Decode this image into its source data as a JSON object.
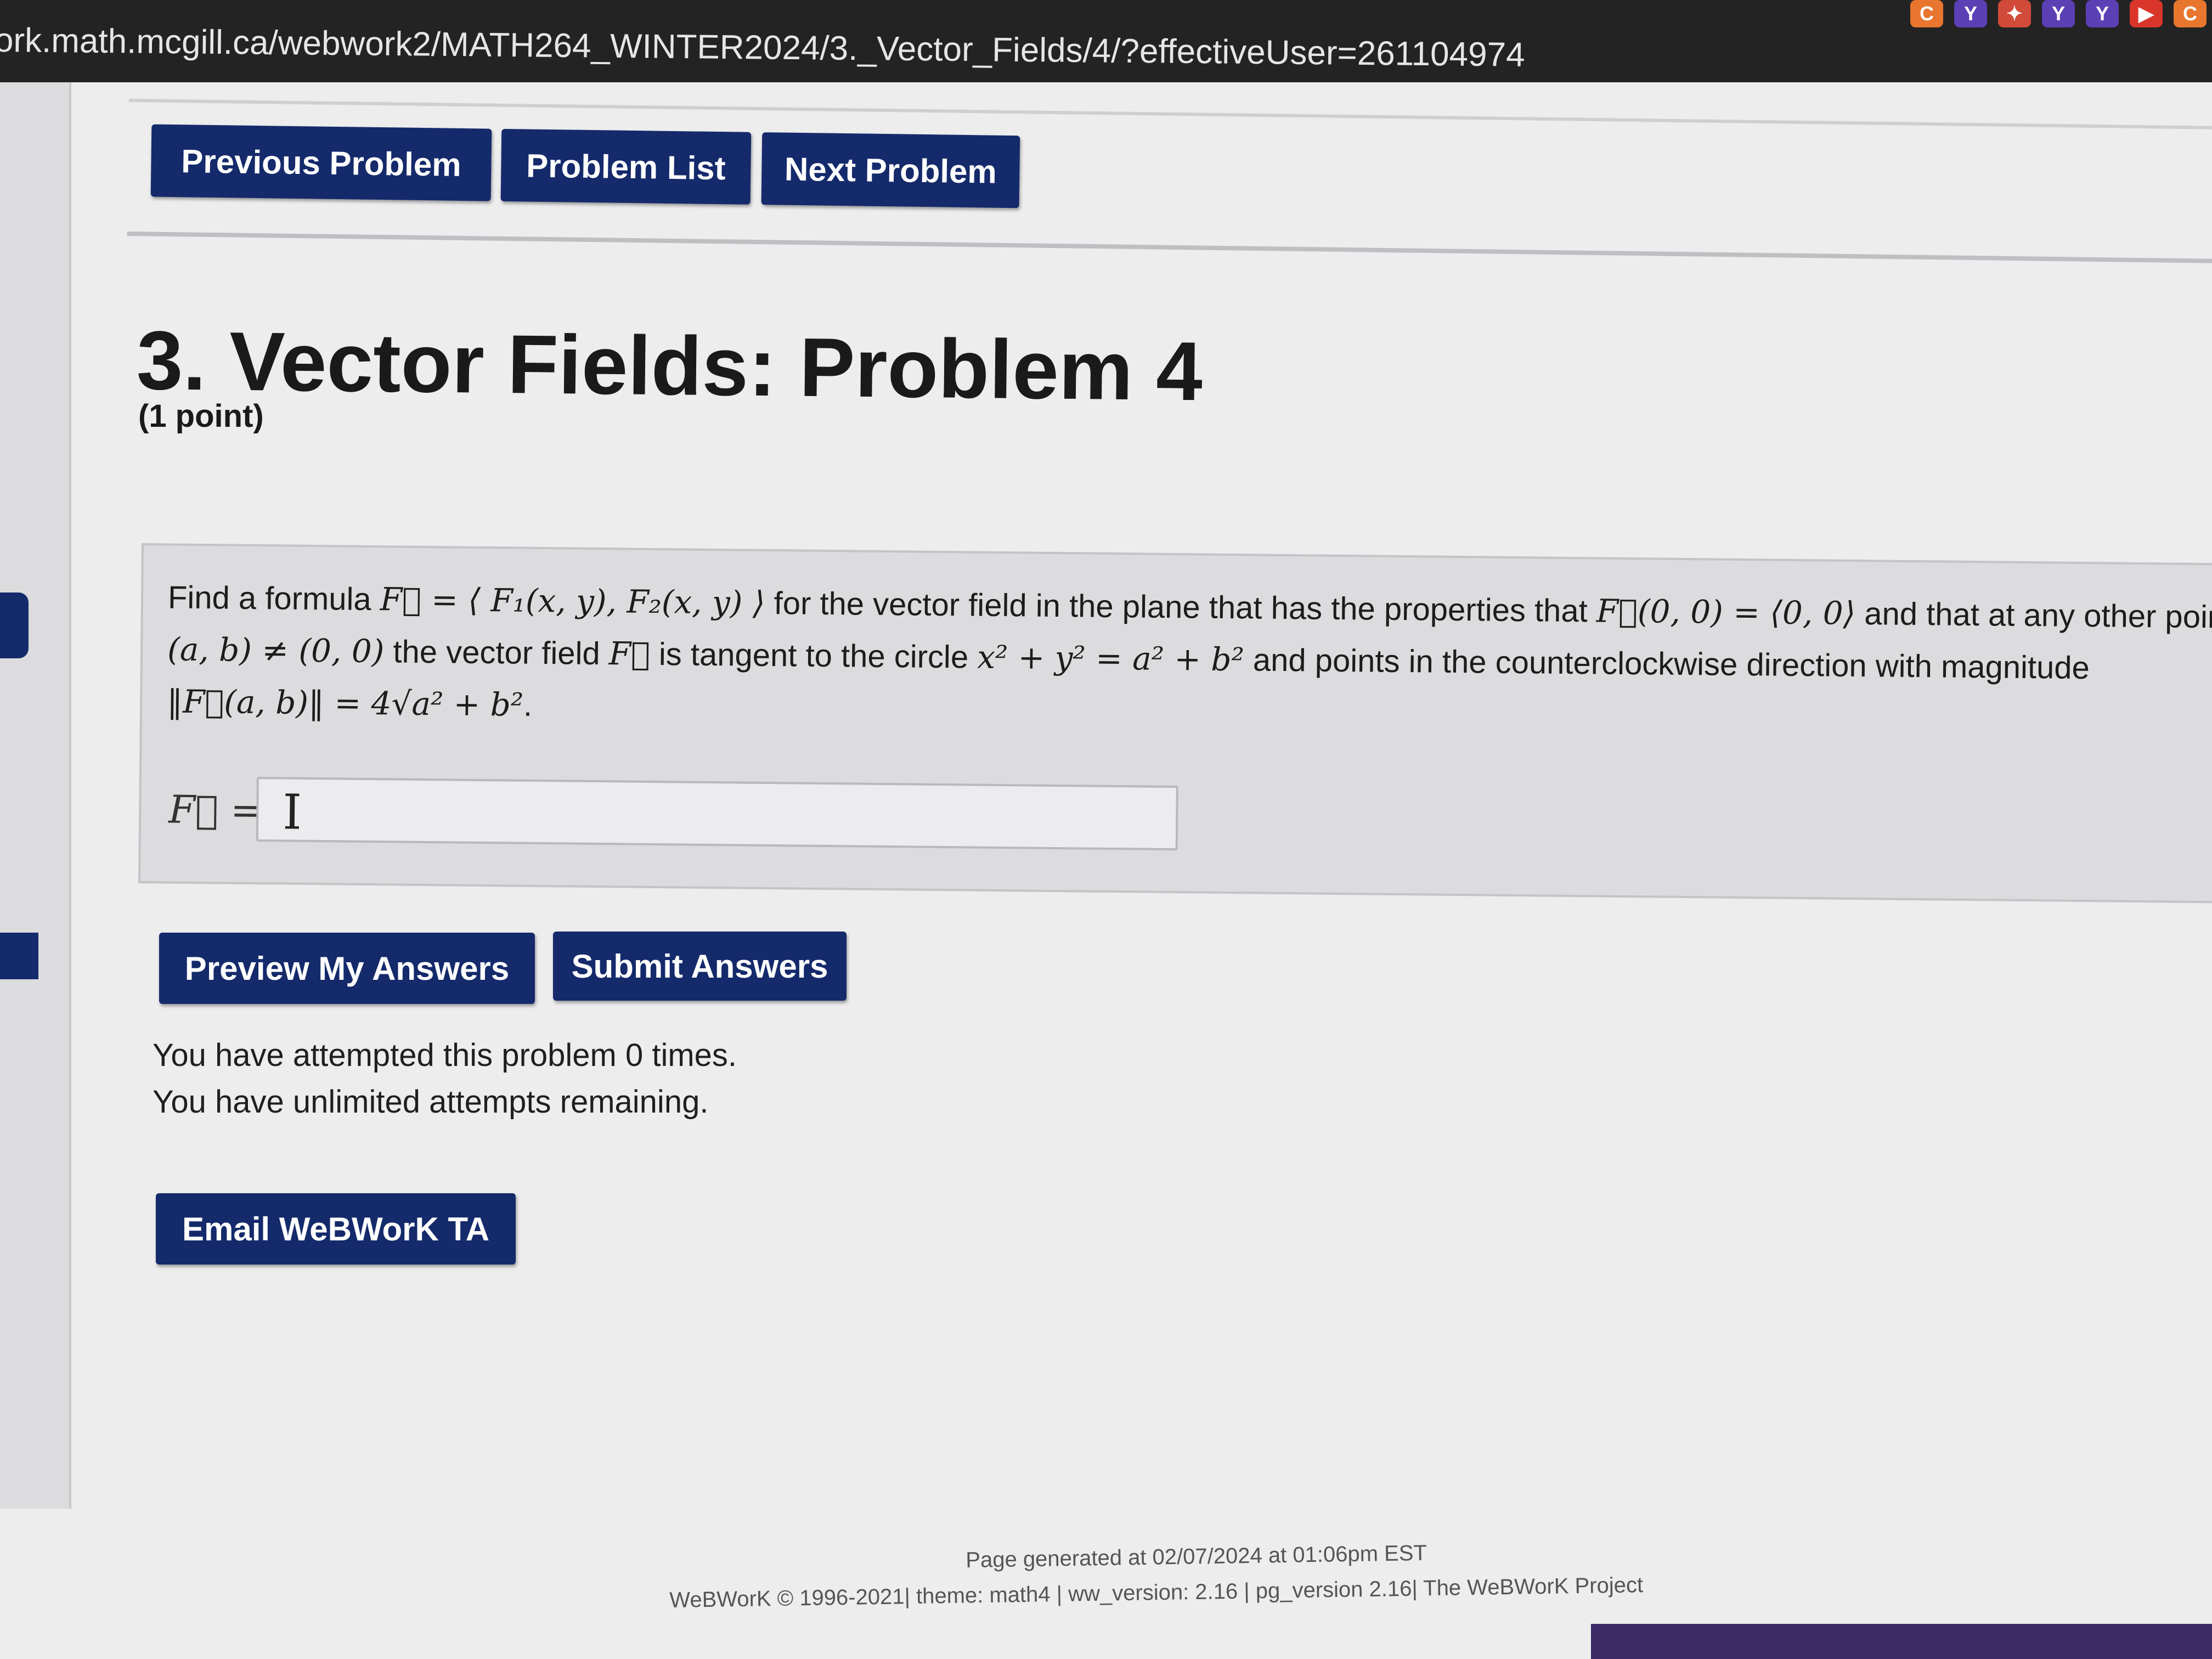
{
  "browser": {
    "url": "ork.math.mcgill.ca/webwork2/MATH264_WINTER2024/3._Vector_Fields/4/?effectiveUser=261104974",
    "extension_icons": [
      {
        "name": "extension-icon-1",
        "glyph": "C",
        "color": "#e8762e"
      },
      {
        "name": "extension-icon-2",
        "glyph": "Y",
        "color": "#5b3fb5"
      },
      {
        "name": "extension-icon-3",
        "glyph": "✦",
        "color": "#d24a3a"
      },
      {
        "name": "extension-icon-4",
        "glyph": "Y",
        "color": "#5b3fb5"
      },
      {
        "name": "extension-icon-5",
        "glyph": "Y",
        "color": "#5b3fb5"
      },
      {
        "name": "extension-icon-6",
        "glyph": "▶",
        "color": "#d9352b"
      },
      {
        "name": "extension-icon-7",
        "glyph": "C",
        "color": "#e8762e"
      }
    ]
  },
  "nav": {
    "previous": "Previous Problem",
    "list": "Problem List",
    "next": "Next Problem"
  },
  "problem": {
    "title": "3. Vector Fields: Problem 4",
    "points": "(1 point)",
    "statement": {
      "l1_a": "Find a formula ",
      "l1_m1": "F⃗ = ⟨ F₁(x, y),  F₂(x, y) ⟩",
      "l1_b": " for the vector field in the plane that has the properties that ",
      "l1_m2": "F⃗(0, 0) = ⟨0, 0⟩",
      "l1_c": " and that at any other point",
      "l2_m1": "(a, b) ≠ (0, 0)",
      "l2_a": " the vector field ",
      "l2_m2": "F⃗",
      "l2_b": " is tangent to the circle ",
      "l2_m3": "x² + y² = a² + b²",
      "l2_c": " and points in the counterclockwise direction with magnitude",
      "l3_m1": "‖F⃗(a, b)‖ = 4√a² + b²",
      "l3_end": "."
    },
    "answer_label": "F⃗ =",
    "answer_value": "",
    "answer_placeholder": ""
  },
  "actions": {
    "preview": "Preview My Answers",
    "submit": "Submit Answers",
    "email": "Email WeBWorK TA"
  },
  "attempts": {
    "line1": "You have attempted this problem 0 times.",
    "line2": "You have unlimited attempts remaining."
  },
  "footer": {
    "generated": "Page generated at 02/07/2024 at 01:06pm EST",
    "credits": "WeBWorK © 1996-2021| theme: math4 | ww_version: 2.16 | pg_version 2.16| The WeBWorK Project"
  },
  "colors": {
    "button_bg": "#142a6b",
    "button_text": "#ffffff",
    "page_bg": "#ededee",
    "problem_box_bg": "#dcdcdf"
  }
}
